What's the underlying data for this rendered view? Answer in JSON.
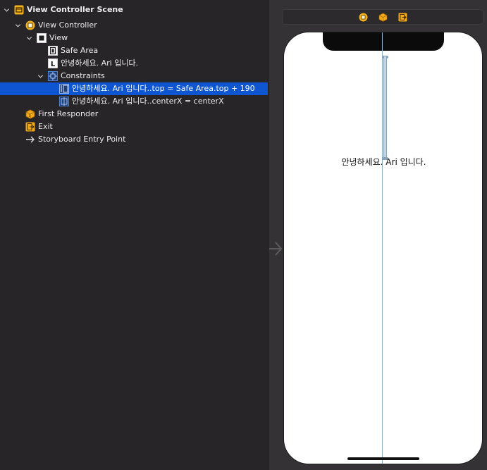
{
  "outline": {
    "scene_title": "View Controller Scene",
    "view_controller": "View Controller",
    "view": "View",
    "safe_area": "Safe Area",
    "label_item": "안녕하세요. Ari 입니다.",
    "constraints_group": "Constraints",
    "constraint_top": "안녕하세요. Ari 입니다..top = Safe Area.top + 190",
    "constraint_centerx": "안녕하세요. Ari 입니다..centerX = centerX",
    "first_responder": "First Responder",
    "exit": "Exit",
    "entry_point": "Storyboard Entry Point"
  },
  "canvas": {
    "label_text": "안녕하세요. Ari 입니다."
  },
  "colors": {
    "selection": "#0e56d1",
    "outline_bg": "#282528",
    "canvas_bg": "#353235",
    "constraint": "#8fb0c8",
    "accent_yellow": "#f2b01c"
  },
  "icons": [
    "disclosure-chevron-icon",
    "scene-icon",
    "view-controller-icon",
    "view-icon",
    "safe-area-icon",
    "label-icon",
    "constraints-icon",
    "constraint-icon",
    "first-responder-icon",
    "exit-icon",
    "entry-point-arrow-icon"
  ]
}
